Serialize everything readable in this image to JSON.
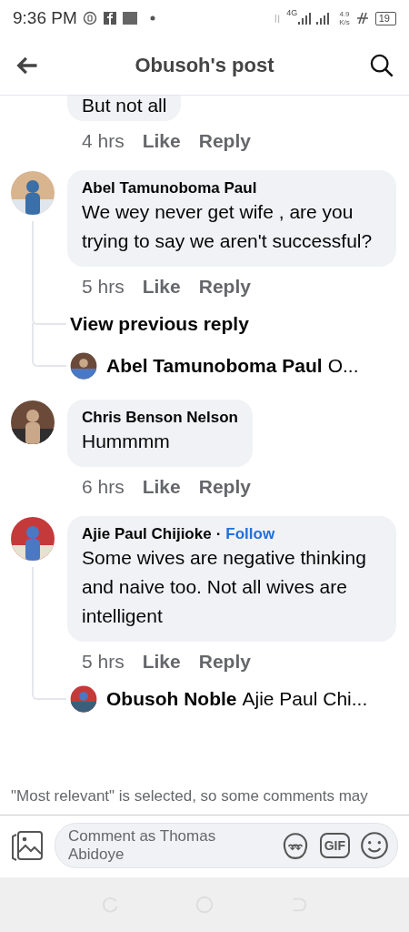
{
  "status_bar": {
    "time": "9:36 PM",
    "network": "4G",
    "speed_value": "4.9",
    "speed_unit": "K/s",
    "battery": "19"
  },
  "header": {
    "title": "Obusoh's post"
  },
  "comments": [
    {
      "kind": "partial",
      "text": "But not all",
      "time": "4 hrs",
      "actions": [
        "Like",
        "Reply"
      ]
    },
    {
      "kind": "full",
      "author": "Abel Tamunoboma Paul",
      "text": "We wey never get wife , are you trying to say we aren't successful?",
      "time": "5 hrs",
      "actions": [
        "Like",
        "Reply"
      ],
      "thread": [
        {
          "kind": "more",
          "label": "View previous reply"
        },
        {
          "kind": "preview",
          "author": "Abel Tamunoboma Paul",
          "snippet": "O..."
        }
      ]
    },
    {
      "kind": "full",
      "author": "Chris Benson Nelson",
      "text": "Hummmm",
      "time": "6 hrs",
      "actions": [
        "Like",
        "Reply"
      ]
    },
    {
      "kind": "full",
      "author": "Ajie Paul Chijioke",
      "follow_separator": "·",
      "follow": "Follow",
      "text": "Some wives are negative thinking and naive too. Not all wives are intelligent",
      "time": "5 hrs",
      "actions": [
        "Like",
        "Reply"
      ],
      "thread": [
        {
          "kind": "preview",
          "author": "Obusoh Noble",
          "snippet": "Ajie Paul Chi..."
        }
      ]
    }
  ],
  "notice": "\"Most relevant\" is selected, so some comments may",
  "composer": {
    "placeholder": "Comment as Thomas Abidoye",
    "gif": "GIF"
  }
}
